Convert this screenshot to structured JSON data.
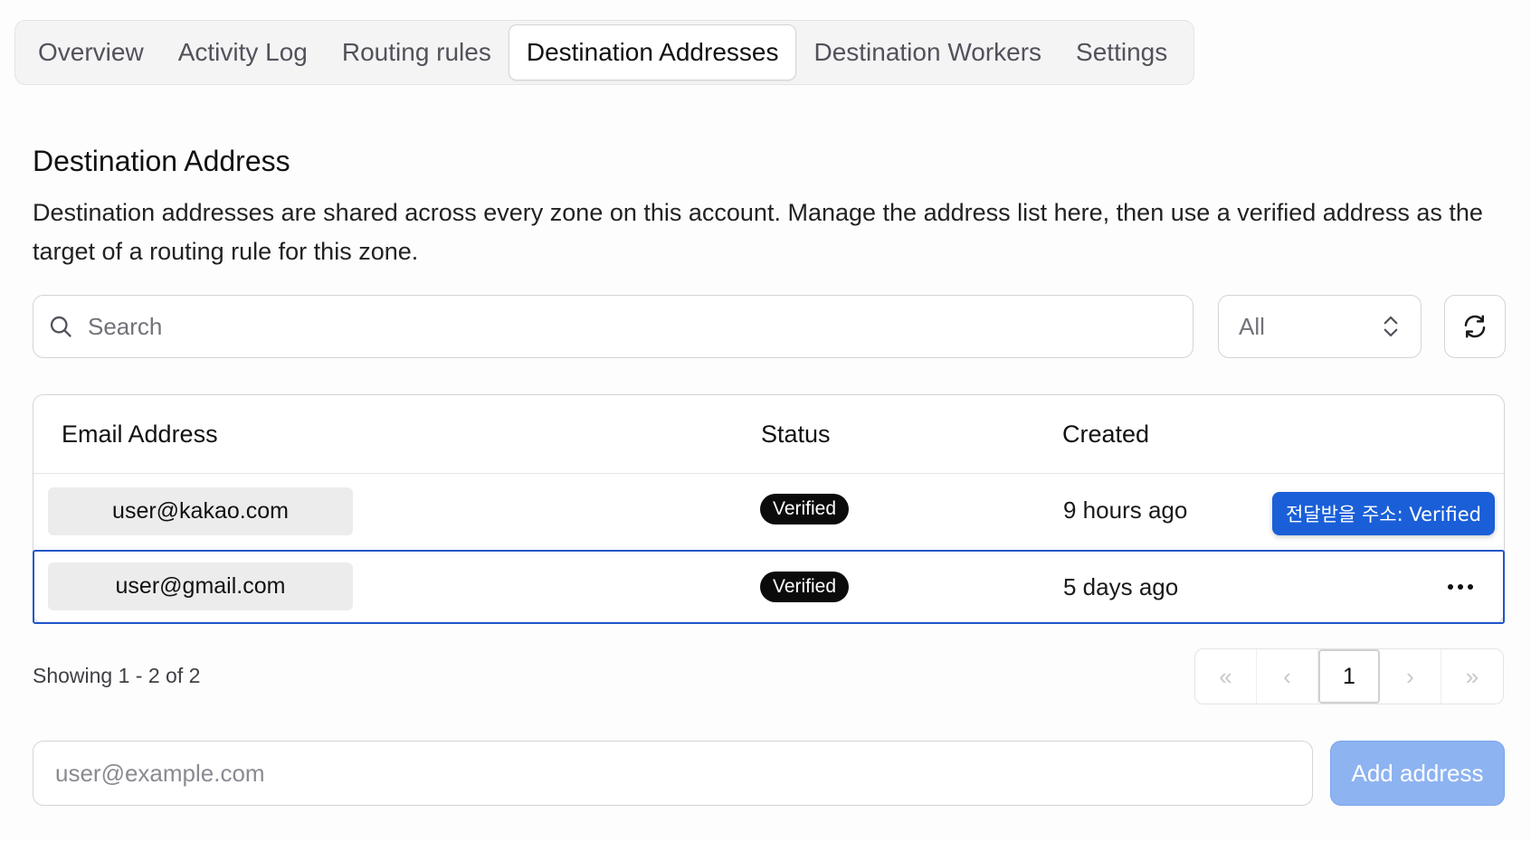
{
  "tabs": [
    {
      "label": "Overview"
    },
    {
      "label": "Activity Log"
    },
    {
      "label": "Routing rules"
    },
    {
      "label": "Destination Addresses",
      "active": true
    },
    {
      "label": "Destination Workers"
    },
    {
      "label": "Settings"
    }
  ],
  "section": {
    "title": "Destination Address",
    "description": "Destination addresses are shared across every zone on this account. Manage the address list here, then use a verified address as the target of a routing rule for this zone."
  },
  "search": {
    "placeholder": "Search",
    "icon": "search-icon"
  },
  "filter": {
    "selected": "All",
    "icon": "chevron-up-down-icon"
  },
  "refresh": {
    "icon": "refresh-icon"
  },
  "table": {
    "columns": [
      "Email Address",
      "Status",
      "Created"
    ],
    "rows": [
      {
        "email": "user@kakao.com",
        "status": "Verified",
        "created": "9 hours ago",
        "tooltip": "전달받을 주소: Verified"
      },
      {
        "email": "user@gmail.com",
        "status": "Verified",
        "created": "5 days ago",
        "selected": true
      }
    ]
  },
  "pagination": {
    "showing": "Showing 1 - 2 of 2",
    "current_page": "1",
    "first": "«",
    "prev": "‹",
    "next": "›",
    "last": "»"
  },
  "add": {
    "placeholder": "user@example.com",
    "button_label": "Add address"
  },
  "colors": {
    "accent": "#1a5fd8",
    "selected_border": "#1e56c9",
    "button_disabled": "#8db3f1",
    "badge_bg": "#0b0b0b"
  }
}
